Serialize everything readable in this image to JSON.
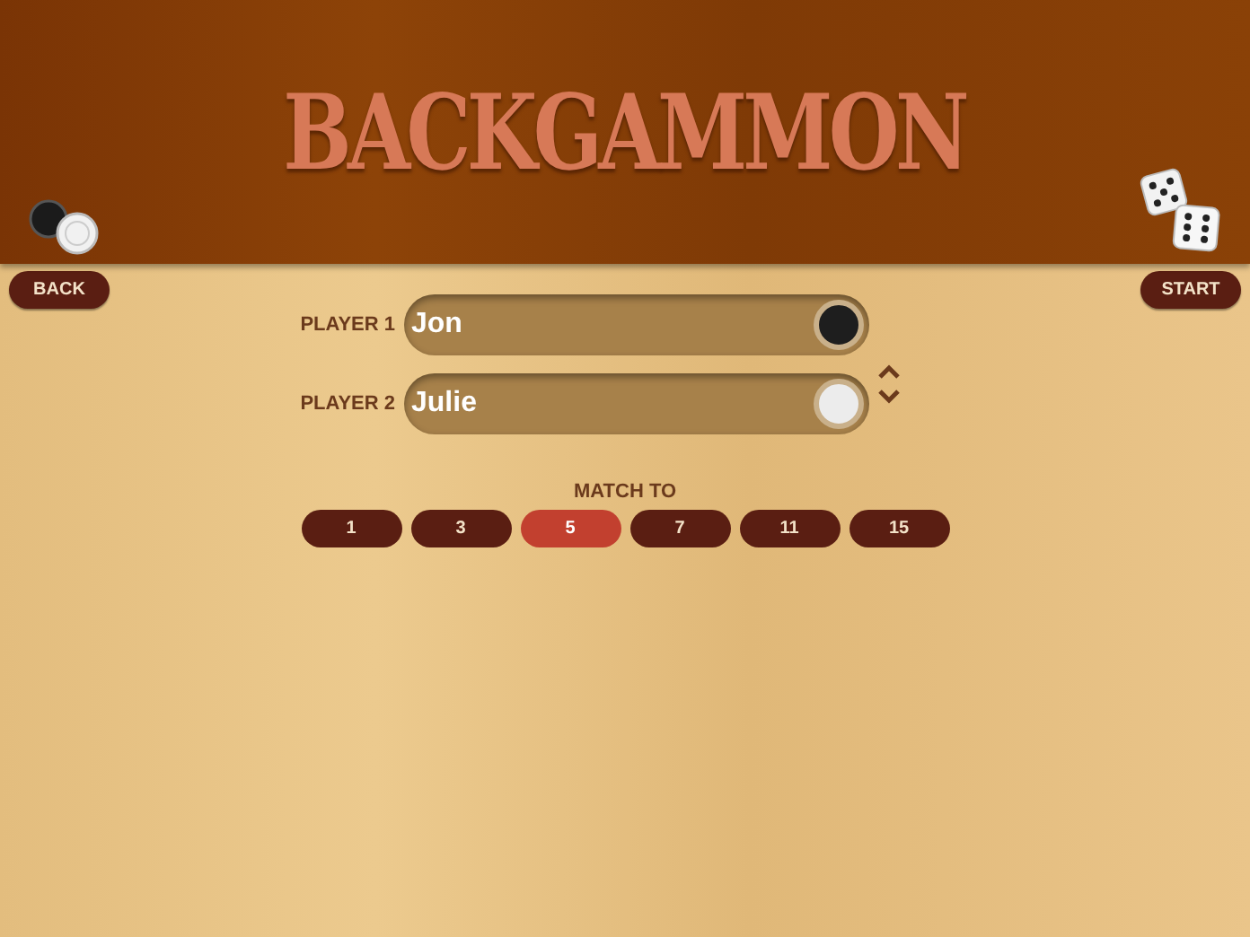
{
  "title": "BACKGAMMON",
  "nav": {
    "back": "BACK",
    "start": "START"
  },
  "players": [
    {
      "label": "PLAYER 1",
      "value": "Jon",
      "color": "#1e1e1e"
    },
    {
      "label": "PLAYER 2",
      "value": "Julie",
      "color": "#ececec"
    }
  ],
  "match": {
    "label": "MATCH TO",
    "options": [
      {
        "label": "1",
        "selected": false
      },
      {
        "label": "3",
        "selected": false
      },
      {
        "label": "5",
        "selected": true
      },
      {
        "label": "7",
        "selected": false
      },
      {
        "label": "11",
        "selected": false
      },
      {
        "label": "15",
        "selected": false
      }
    ]
  }
}
